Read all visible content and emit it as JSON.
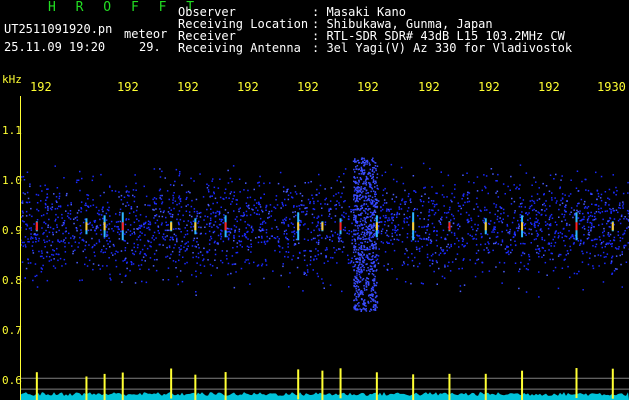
{
  "app": {
    "title": "H R O F F T"
  },
  "capture": {
    "filename": "UT2511091920.pn",
    "type_label": "meteor",
    "datetime": "25.11.09 19:20",
    "count": "29."
  },
  "info": [
    {
      "label": "Observer",
      "value": ": Masaki Kano"
    },
    {
      "label": "Receiving Location",
      "value": ": Shibukawa, Gunma, Japan"
    },
    {
      "label": "Receiver",
      "value": ": RTL-SDR SDR# 43dB L15 103.2MHz CW"
    },
    {
      "label": "Receiving Antenna",
      "value": ": 3el Yagi(V) Az 330 for Vladivostok"
    }
  ],
  "axis": {
    "unit": "kHz",
    "minute_labels": [
      "192",
      "192",
      "192",
      "192",
      "192",
      "192",
      "192",
      "192",
      "192",
      "1930"
    ],
    "y_labels": [
      "1.1",
      "1.0",
      "0.9",
      "0.8",
      "0.7",
      "0.6"
    ]
  },
  "colors": {
    "text_yellow": "#ffff33",
    "text_green": "#22dd22",
    "grid": "#808080",
    "noise_blue": "#1a2aff",
    "echo_red": "#ff2020",
    "trace_cyan": "#00e5ff"
  },
  "chart_data": {
    "type": "heatmap",
    "x_unit": "minute",
    "x_ticks": [
      "192",
      "192",
      "192",
      "192",
      "192",
      "192",
      "192",
      "192",
      "192",
      "1930"
    ],
    "ylabel": "kHz",
    "y_ticks": [
      1.1,
      1.0,
      0.9,
      0.8,
      0.7,
      0.6
    ],
    "ylim": [
      0.58,
      1.14
    ],
    "signal_band_khz": [
      0.8,
      1.0
    ],
    "meteor_echoes_minutes": [
      0.08,
      0.9,
      1.2,
      1.5,
      2.3,
      2.7,
      3.2,
      4.4,
      4.8,
      5.1,
      5.7,
      6.3,
      6.9,
      7.5,
      8.1,
      9.0,
      9.6,
      9.9
    ]
  }
}
